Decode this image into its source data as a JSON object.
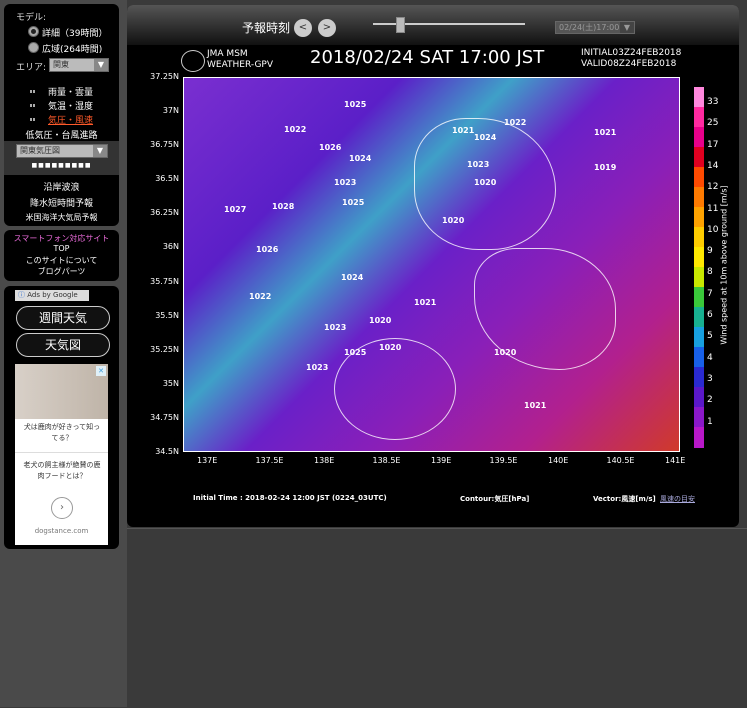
{
  "sidebar": {
    "model_label": "モデル:",
    "model_options": [
      "詳細（39時間）",
      "広域(264時間)"
    ],
    "area_label": "エリア:",
    "area_value": "関東",
    "layers": [
      "雨量・雲量",
      "気温・湿度",
      "気圧・風速"
    ],
    "layers_extra": "低気圧・台風進路",
    "layer_select_value": "関東気圧図",
    "dots": "■■■■■■■■■",
    "links": [
      "沿岸波浪",
      "降水短時間予報",
      "米国海洋大気局予報"
    ],
    "info_links": [
      "スマートフォン対応サイト",
      "TOP",
      "このサイトについて",
      "ブログパーツ"
    ],
    "ads_label": "Ads by Google",
    "weekly_button": "週間天気",
    "chart_button": "天気図",
    "ad_text1": "犬は鹿肉が好きって知ってる？",
    "ad_text2": "老犬の飼主様が絶賛の鹿肉フードとは？",
    "ad_domain": "dogstance.com"
  },
  "toolbar": {
    "forecast_label": "予報時刻",
    "prev": "<",
    "next": ">",
    "time_select": "02/24(土)17:00",
    "slider_position": 0.15
  },
  "map": {
    "logo": "JMA MSM\nWEATHER-GPV",
    "headline": "2018/02/24  SAT  17:00 JST",
    "init_line1": "INITIAL03Z24FEB2018",
    "init_line2": "VALID08Z24FEB2018",
    "lat_ticks": [
      "37.25N",
      "37N",
      "36.75N",
      "36.5N",
      "36.25N",
      "36N",
      "35.75N",
      "35.5N",
      "35.25N",
      "35N",
      "34.75N",
      "34.5N"
    ],
    "lon_ticks": [
      "137E",
      "137.5E",
      "138E",
      "138.5E",
      "139E",
      "139.5E",
      "140E",
      "140.5E",
      "141E"
    ],
    "isobar_labels": [
      "1025",
      "1022",
      "1026",
      "1024",
      "1023",
      "1027",
      "1028",
      "1025",
      "1026",
      "1022",
      "1023",
      "1024",
      "1025",
      "1023",
      "1020",
      "1021",
      "1020",
      "1024",
      "1021",
      "1022",
      "1021",
      "1023",
      "1020",
      "1020",
      "1019",
      "1020",
      "1021"
    ],
    "colorbar_title": "Wind speed at 10m above ground [m/s]",
    "colorbar_ticks": [
      "33",
      "25",
      "17",
      "14",
      "12",
      "11",
      "10",
      "9",
      "8",
      "7",
      "6",
      "5",
      "4",
      "3",
      "2",
      "1"
    ],
    "colorbar_colors": [
      "#ff88dd",
      "#ff2aa0",
      "#e8008a",
      "#e00020",
      "#ff4a00",
      "#ff7a00",
      "#ffa200",
      "#ffcc00",
      "#ffe800",
      "#c8e800",
      "#3ac83a",
      "#18b090",
      "#18a0e0",
      "#1860e8",
      "#2a2ad0",
      "#5a18c8",
      "#8a18c8",
      "#b818c8"
    ]
  },
  "footer": {
    "initial_time": "Initial Time : 2018-02-24 12:00 JST (0224_03UTC)",
    "contour": "Contour:気圧[hPa]",
    "vector": "Vector:風速[m/s]",
    "wind_link": "風速の目安"
  }
}
